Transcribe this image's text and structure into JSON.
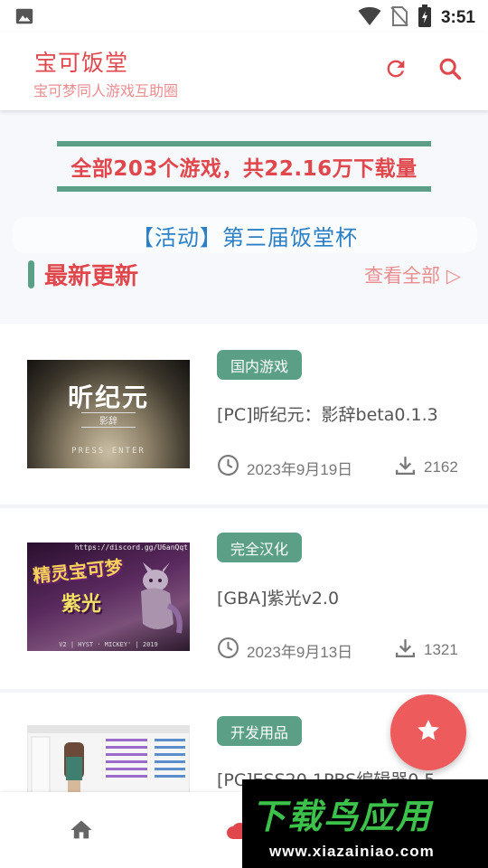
{
  "status_bar": {
    "time": "3:51"
  },
  "header": {
    "title": "宝可饭堂",
    "subtitle": "宝可梦同人游戏互助圈"
  },
  "hero": {
    "stats": "全部203个游戏，共22.16万下载量",
    "event": "【活动】第三届饭堂杯",
    "section_title": "最新更新",
    "view_all": "查看全部 ▷"
  },
  "games": [
    {
      "tag": "国内游戏",
      "title": "[PC]昕纪元：影辞beta0.1.3",
      "date": "2023年9月19日",
      "downloads": "2162",
      "thumb": {
        "title": "昕纪元",
        "subtitle": "影辞",
        "prompt": "PRESS ENTER"
      }
    },
    {
      "tag": "完全汉化",
      "title": "[GBA]紫光v2.0",
      "date": "2023年9月13日",
      "downloads": "1321",
      "thumb": {
        "url": "https://discord.gg/U6anQqt",
        "logo": "精灵宝可梦",
        "subtitle": "紫光",
        "credits": "V2 | HYST · MICKEY' | 2019"
      }
    },
    {
      "tag": "开发用品",
      "title": "[PC]ESS20.1PBS编辑器0.5",
      "date": "",
      "downloads": ""
    }
  ],
  "watermark": {
    "big": "下载鸟应用",
    "small": "www.xiazainiao.com"
  },
  "colors": {
    "primary_red": "#e0474c",
    "accent_green": "#5a9f86",
    "event_blue": "#2a7fc6"
  },
  "icons": [
    "image-icon",
    "wifi-icon",
    "no-sim-icon",
    "battery-icon",
    "refresh-icon",
    "search-icon",
    "clock-icon",
    "download-icon",
    "star-icon",
    "home-icon",
    "cloud-icon"
  ]
}
